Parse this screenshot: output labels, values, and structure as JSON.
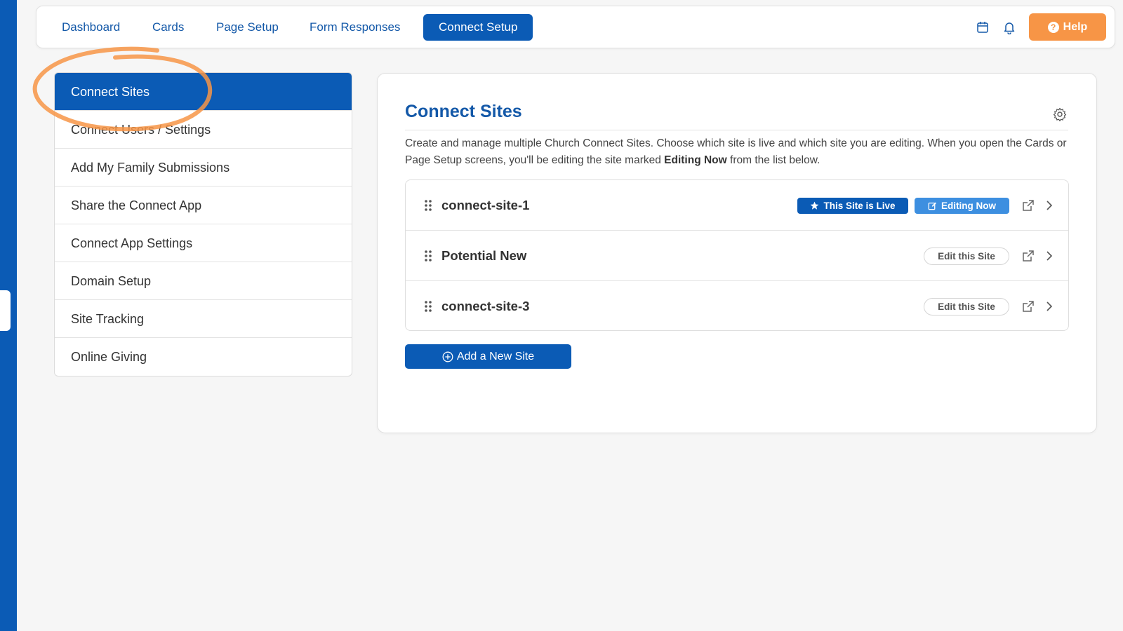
{
  "topnav": {
    "tabs": [
      {
        "label": "Dashboard"
      },
      {
        "label": "Cards"
      },
      {
        "label": "Page Setup"
      },
      {
        "label": "Form Responses"
      },
      {
        "label": "Connect Setup",
        "active": true
      }
    ],
    "icons": [
      "calendar-icon",
      "bell-icon"
    ],
    "help_label": "Help"
  },
  "sidebar": {
    "items": [
      {
        "label": "Connect Sites",
        "active": true
      },
      {
        "label": "Connect Users / Settings"
      },
      {
        "label": "Add My Family Submissions"
      },
      {
        "label": "Share the Connect App"
      },
      {
        "label": "Connect App Settings"
      },
      {
        "label": "Domain Setup"
      },
      {
        "label": "Site Tracking"
      },
      {
        "label": "Online Giving"
      }
    ]
  },
  "main": {
    "title": "Connect Sites",
    "description_pre": "Create and manage multiple Church Connect Sites. Choose which site is live and which site you are editing. When you open the Cards or Page Setup screens, you'll be editing the site marked ",
    "description_bold": "Editing Now",
    "description_post": " from the list below.",
    "sites": [
      {
        "name": "connect-site-1",
        "live_label": "This Site is Live",
        "editing_label": "Editing Now"
      },
      {
        "name": "Potential New",
        "edit_label": "Edit this Site"
      },
      {
        "name": "connect-site-3",
        "edit_label": "Edit this Site"
      }
    ],
    "add_site_label": "Add a New Site"
  },
  "colors": {
    "primary": "#0b5bb5",
    "accent_orange": "#f79546",
    "editing_blue": "#3d8fe0",
    "link_blue": "#1358a8"
  }
}
